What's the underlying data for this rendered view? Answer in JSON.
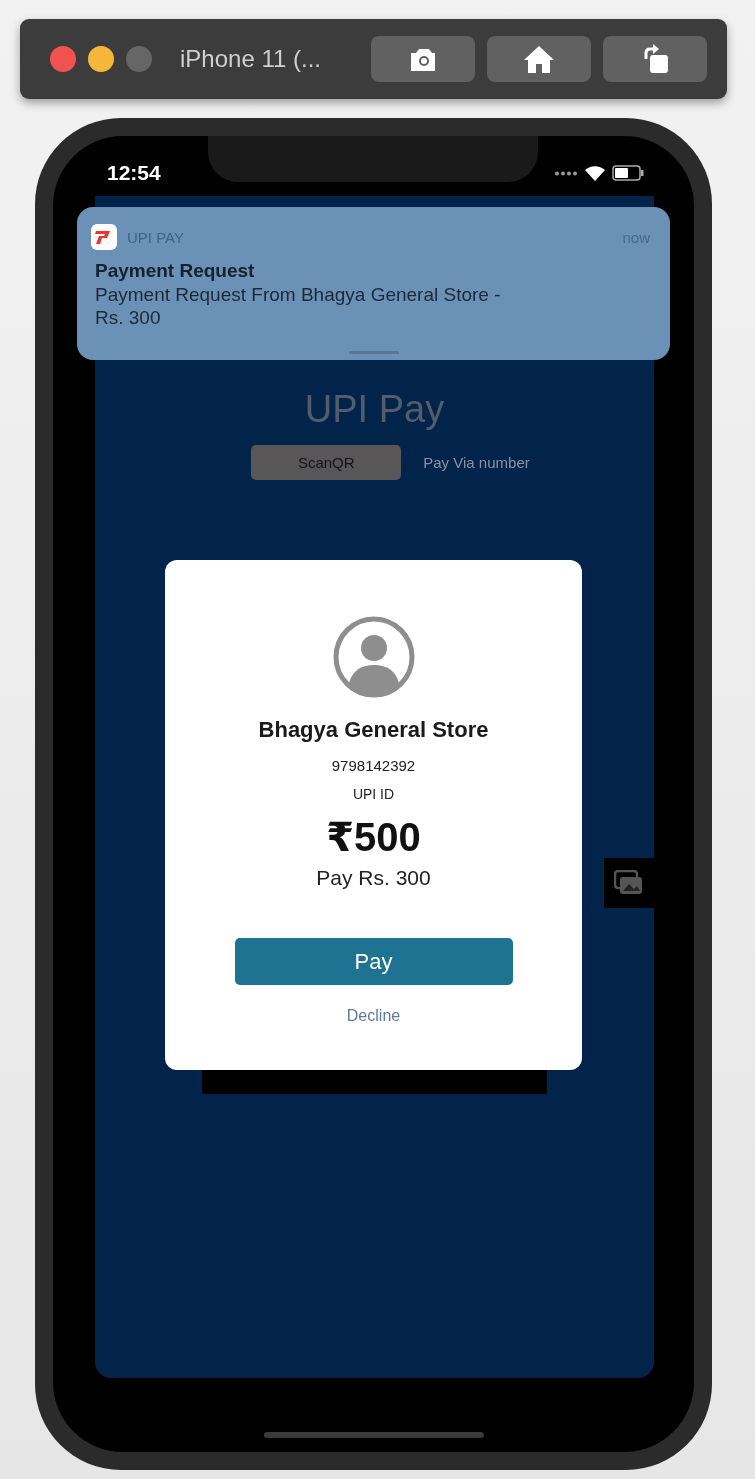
{
  "simulator": {
    "title": "iPhone 11 (..."
  },
  "status_bar": {
    "time": "12:54"
  },
  "notification": {
    "app": "UPI PAY",
    "time": "now",
    "title": "Payment Request",
    "body": "Payment Request From Bhagya General Store - Rs. 300"
  },
  "app": {
    "title": "UPI Pay",
    "tabs": [
      {
        "label": "ScanQR",
        "selected": true
      },
      {
        "label": "Pay Via number",
        "selected": false
      }
    ]
  },
  "dialog": {
    "name": "Bhagya General Store",
    "phone": "9798142392",
    "upi_label": "UPI ID",
    "amount": "₹500",
    "subtitle": "Pay Rs. 300",
    "primary": "Pay",
    "secondary": "Decline"
  }
}
